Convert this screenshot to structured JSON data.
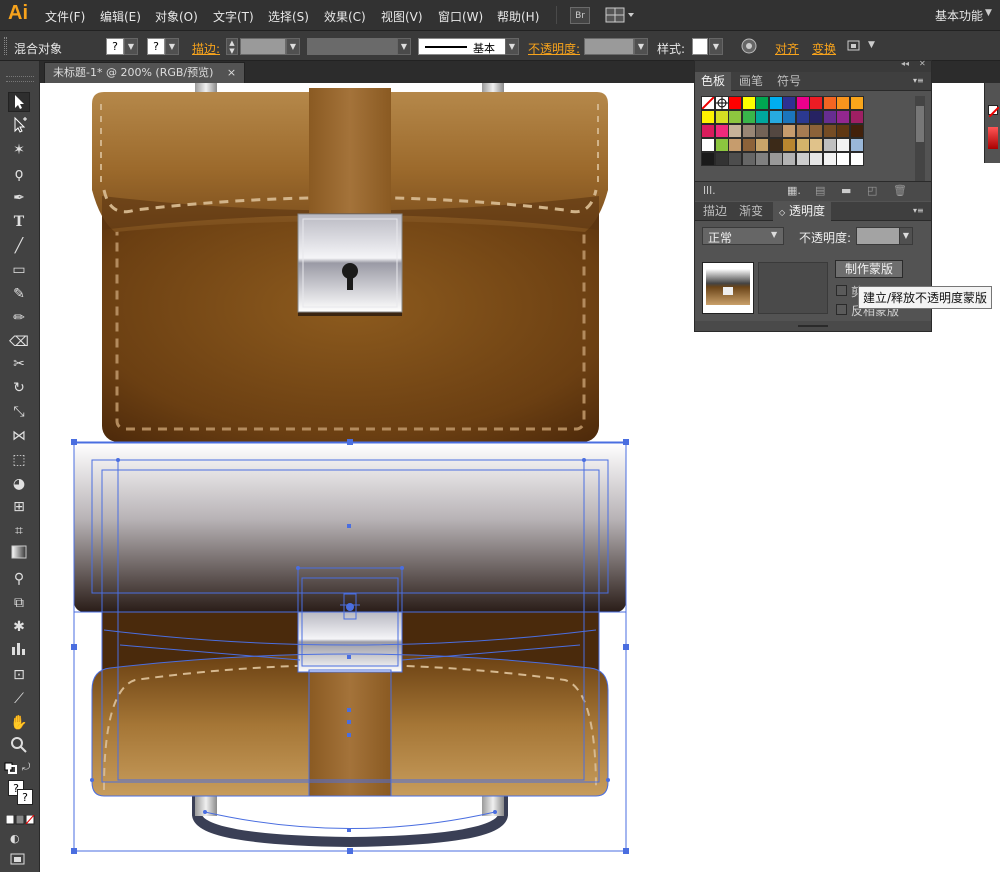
{
  "app": {
    "logo": "Ai",
    "workspace": "基本功能",
    "bridge": "Br"
  },
  "menu": [
    "文件(F)",
    "编辑(E)",
    "对象(O)",
    "文字(T)",
    "选择(S)",
    "效果(C)",
    "视图(V)",
    "窗口(W)",
    "帮助(H)"
  ],
  "control": {
    "object_type": "混合对象",
    "fill_value": "?",
    "stroke_value": "?",
    "stroke_label": "描边:",
    "stroke_style": "基本",
    "opacity_label": "不透明度:",
    "style_label": "样式:",
    "align_label": "对齐",
    "transform_label": "变换"
  },
  "document_tab": {
    "title": "未标题-1* @ 200% (RGB/预览)",
    "close": "×"
  },
  "panel": {
    "top_tabs": [
      "色板",
      "画笔",
      "符号"
    ],
    "bottom_tabs": [
      "描边",
      "渐变",
      "透明度"
    ],
    "blend_mode": "正常",
    "opacity_label": "不透明度:",
    "make_mask_button": "制作蒙版",
    "checkbox_clip": "剪",
    "checkbox_invert": "反相蒙版"
  },
  "tooltip": "建立/释放不透明度蒙版",
  "colors": {
    "accent": "#f7a31c",
    "leather_light": "#c28a3d",
    "leather_dark": "#4f2c0c",
    "selection": "#4a6ee0"
  },
  "swatches": [
    [
      "#ffffff",
      "#ffffff",
      "#ff0000",
      "#ffff00",
      "#00a651",
      "#00aeef",
      "#2e3192",
      "#ec008c",
      "#ed1c24",
      "#f26522",
      "#f7941d",
      "#f9a61b"
    ],
    [
      "#fff200",
      "#d7df23",
      "#8dc63f",
      "#39b54a",
      "#00a79d",
      "#27aae1",
      "#1b75bc",
      "#2b3990",
      "#262262",
      "#662d91",
      "#92278f",
      "#9e1f63"
    ],
    [
      "#d91c5c",
      "#ee2a7b",
      "#c7b299",
      "#998675",
      "#736357",
      "#534741",
      "#c69c6d",
      "#a67c52",
      "#8c6239",
      "#754c24",
      "#603813",
      "#42210b"
    ],
    [
      "#ffffff",
      "#8cc63f",
      "#c69c6d",
      "#8c6239",
      "#c7a46a",
      "#3c2a18",
      "#b8862f",
      "#d4b36a",
      "#e0c28a",
      "#bfbfbf",
      "#f2f2f2",
      "#9ab7d8"
    ],
    [
      "#1a1a1a",
      "#333333",
      "#4d4d4d",
      "#666666",
      "#808080",
      "#999999",
      "#b3b3b3",
      "#cccccc",
      "#e6e6e6",
      "#f2f2f2",
      "#ffffff",
      "#ffffff"
    ]
  ]
}
